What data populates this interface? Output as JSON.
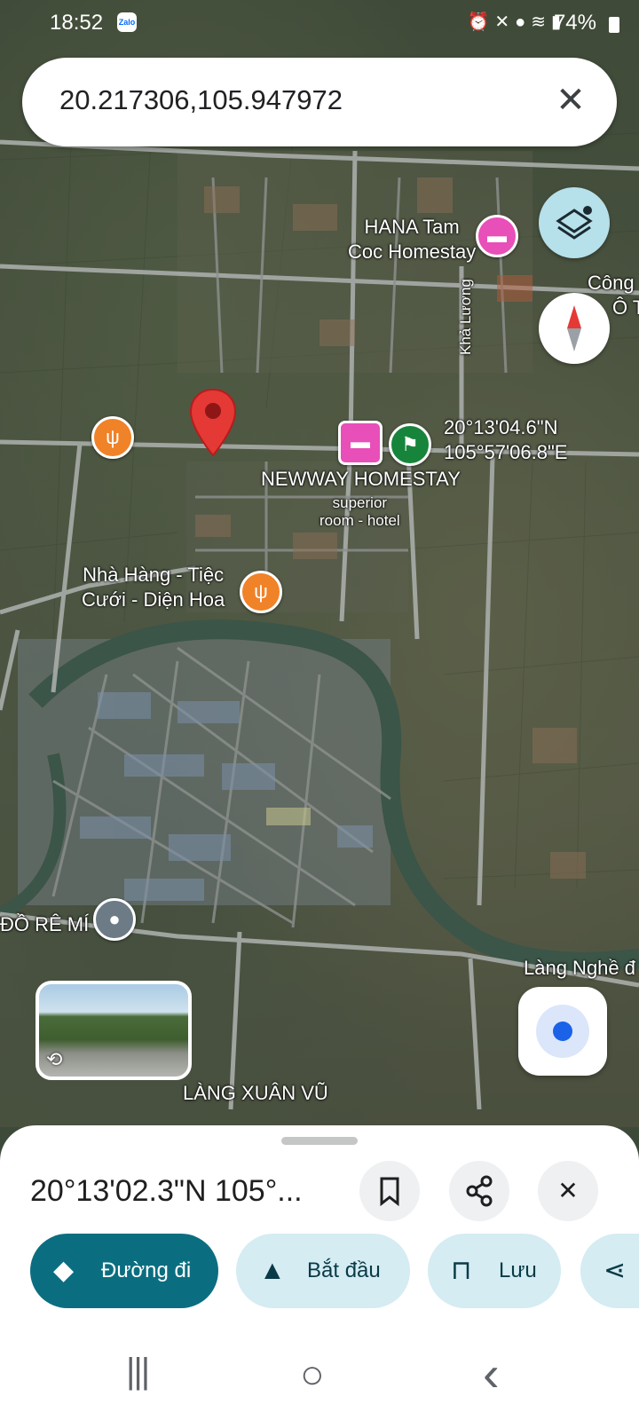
{
  "status_bar": {
    "time": "18:52",
    "app_badge": "Zalo",
    "battery": "74%",
    "icons": [
      "alarm-icon",
      "mute-icon",
      "location-icon",
      "wifi-icon",
      "signal-icon"
    ]
  },
  "search": {
    "query": "20.217306,105.947972",
    "clear_icon": "close-icon"
  },
  "map": {
    "labels": {
      "hana": "HANA Tam\nCoc Homestay",
      "cong": "Công",
      "cong2": "Ô T",
      "road_kha_luong": "Khả Lương",
      "coord_dms": "20°13'04.6\"N\n105°57'06.8\"E",
      "newway": "NEWWAY HOMESTAY",
      "newway_sub": "superior\nroom - hotel",
      "nha_hang": "Nhà Hàng - Tiệc\nCưới - Diện Hoa",
      "do_re_mi": "ĐỒ RÊ MÍ",
      "lang_nghe": "Làng Nghề đ",
      "lang_xuan_vu": "LÀNG XUÂN VŨ"
    },
    "controls": {
      "layers_icon": "layers-icon",
      "compass_icon": "compass-icon",
      "my_location_icon": "my-location-icon"
    },
    "colors": {
      "pin": "#e53935",
      "food_poi": "#f08228",
      "hotel_poi": "#e84fb8",
      "flag_poi": "#17843b"
    }
  },
  "place_sheet": {
    "title": "20°13'02.3\"N 105°...",
    "save_icon": "bookmark-icon",
    "share_icon": "share-icon",
    "close_icon": "close-icon",
    "actions": {
      "directions": "Đường đi",
      "start": "Bắt đầu",
      "save": "Lưu"
    },
    "accent": "#0b6e80"
  },
  "nav_bar": {
    "recent": "|||",
    "home": "○",
    "back": "‹"
  }
}
